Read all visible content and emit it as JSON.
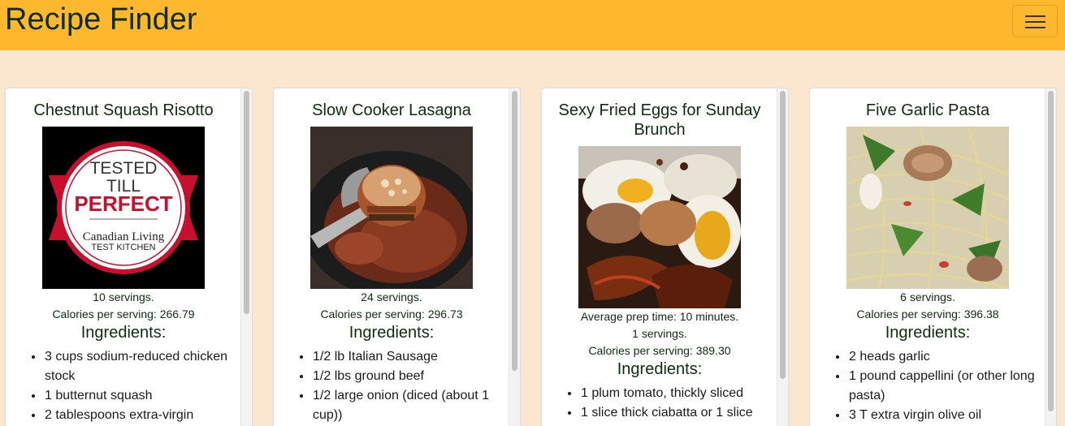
{
  "navbar": {
    "brand": "Recipe Finder",
    "toggle_icon": "hamburger-menu-icon"
  },
  "recipes": [
    {
      "title": "Chestnut Squash Risotto",
      "image_icon": "tested-till-perfect-badge",
      "badge_text": {
        "line1": "TESTED",
        "line2": "TILL",
        "line3": "PERFECT",
        "line4": "Canadian Living",
        "line5": "TEST KITCHEN"
      },
      "servings": "10 servings.",
      "calories": "Calories per serving: 266.79",
      "ingredients_heading": "Ingredients:",
      "ingredients": [
        "3 cups sodium-reduced chicken stock",
        "1 butternut squash",
        "2 tablespoons extra-virgin"
      ]
    },
    {
      "title": "Slow Cooker Lasagna",
      "image_icon": "lasagna-photo",
      "servings": "24 servings.",
      "calories": "Calories per serving: 296.73",
      "ingredients_heading": "Ingredients:",
      "ingredients": [
        "1/2 lb Italian Sausage",
        "1/2 lbs ground beef",
        "1/2 large onion (diced (about 1 cup))"
      ]
    },
    {
      "title": "Sexy Fried Eggs for Sunday Brunch",
      "image_icon": "fried-eggs-photo",
      "prep_time": "Average prep time: 10 minutes.",
      "servings": "1 servings.",
      "calories": "Calories per serving: 389.30",
      "ingredients_heading": "Ingredients:",
      "ingredients": [
        "1 plum tomato, thickly sliced",
        "1 slice thick ciabatta or 1 slice"
      ]
    },
    {
      "title": "Five Garlic Pasta",
      "image_icon": "garlic-pasta-photo",
      "servings": "6 servings.",
      "calories": "Calories per serving: 396.38",
      "ingredients_heading": "Ingredients:",
      "ingredients": [
        "2 heads garlic",
        "1 pound cappellini (or other long pasta)",
        "3 T extra virgin olive oil"
      ]
    }
  ]
}
